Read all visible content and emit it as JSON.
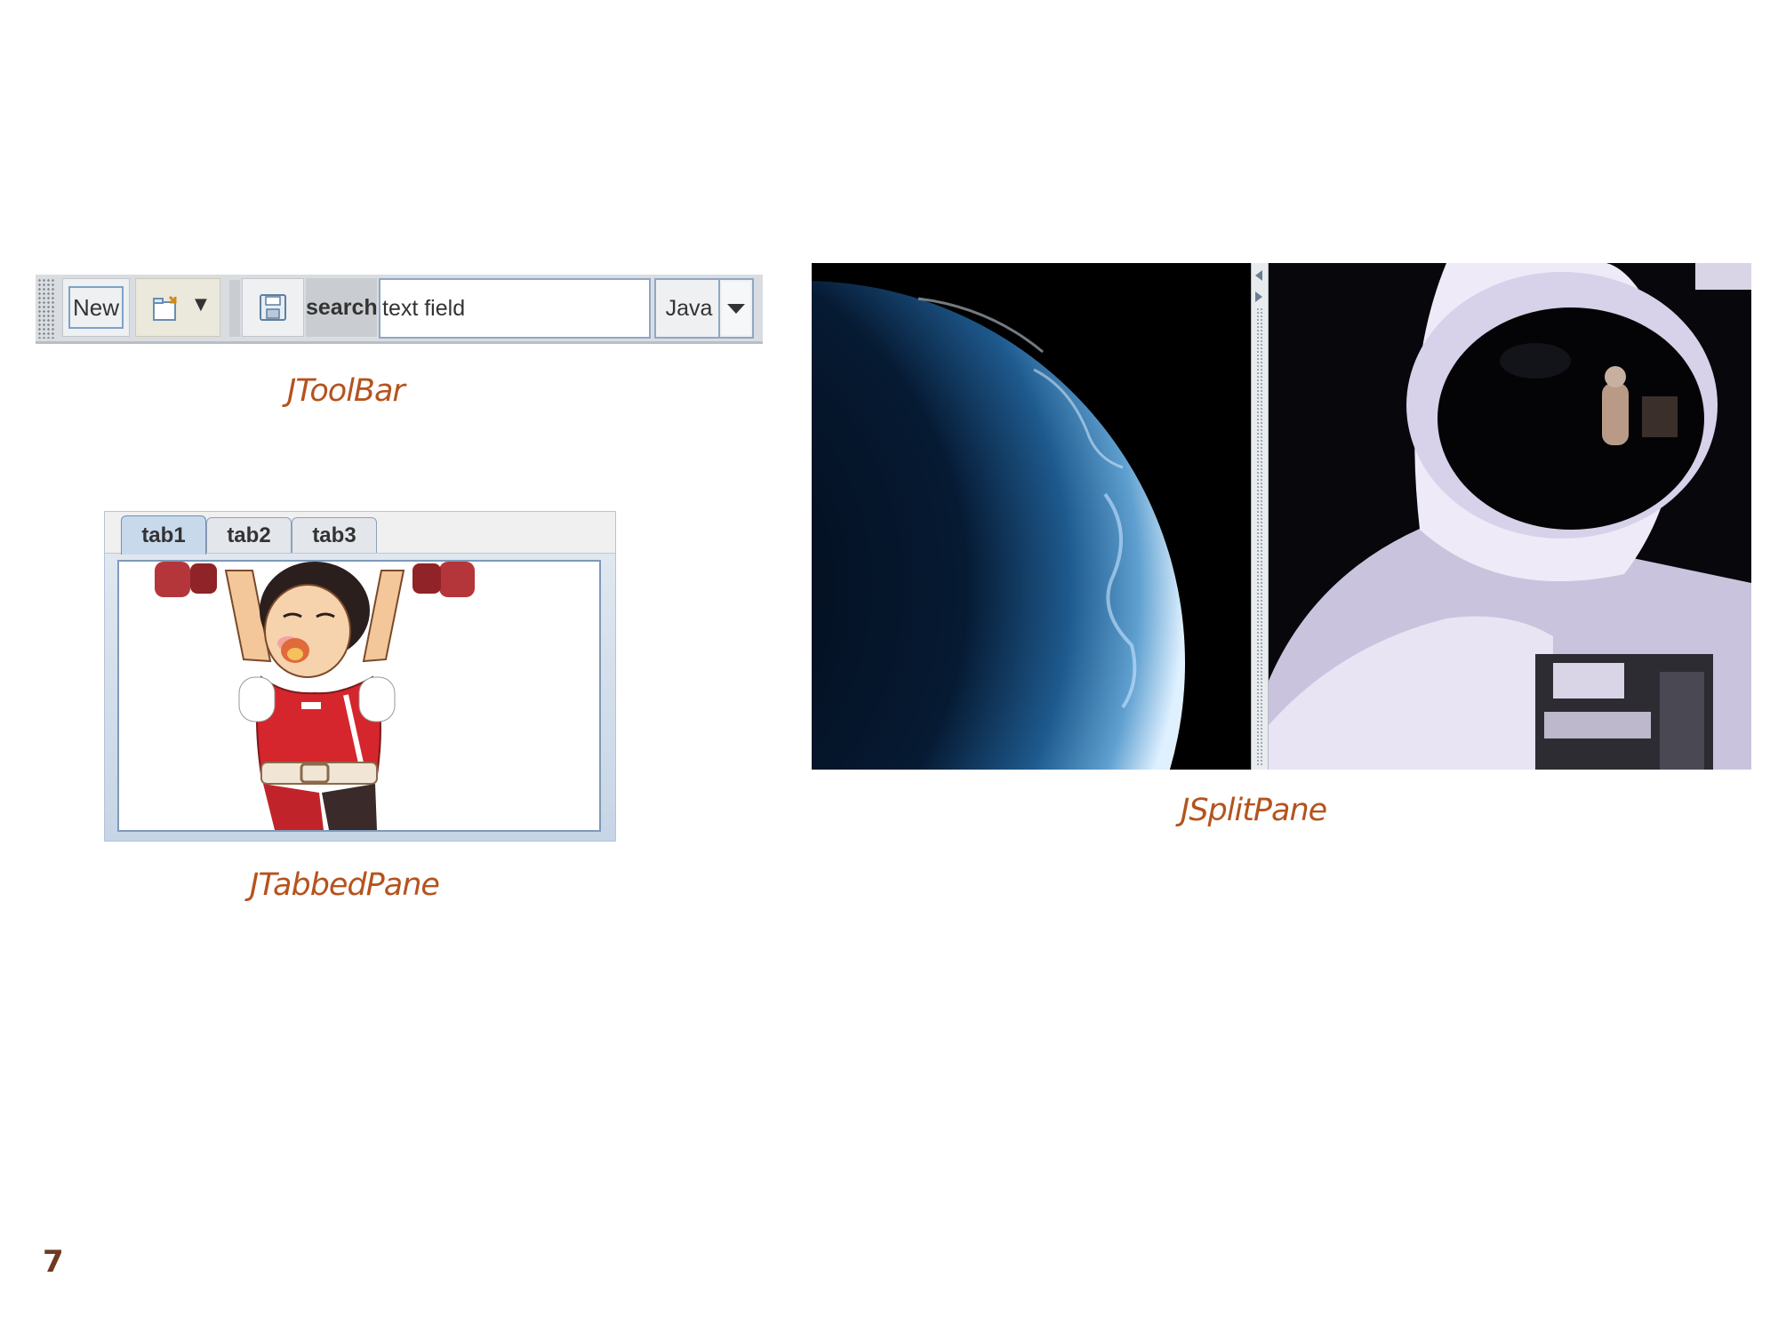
{
  "toolbar": {
    "new_label": "New",
    "open_icon": "open-folder-icon",
    "save_icon": "floppy-disk-icon",
    "search_label": "search",
    "search_value": "text field",
    "combo_value": "Java",
    "caption": "JToolBar"
  },
  "tabbed": {
    "tabs": [
      {
        "label": "tab1",
        "selected": true
      },
      {
        "label": "tab2",
        "selected": false
      },
      {
        "label": "tab3",
        "selected": false
      }
    ],
    "caption": "JTabbedPane"
  },
  "split": {
    "caption": "JSplitPane"
  },
  "page_number": "7",
  "colors": {
    "caption": "#b5531e",
    "page_number": "#6e3b22"
  }
}
